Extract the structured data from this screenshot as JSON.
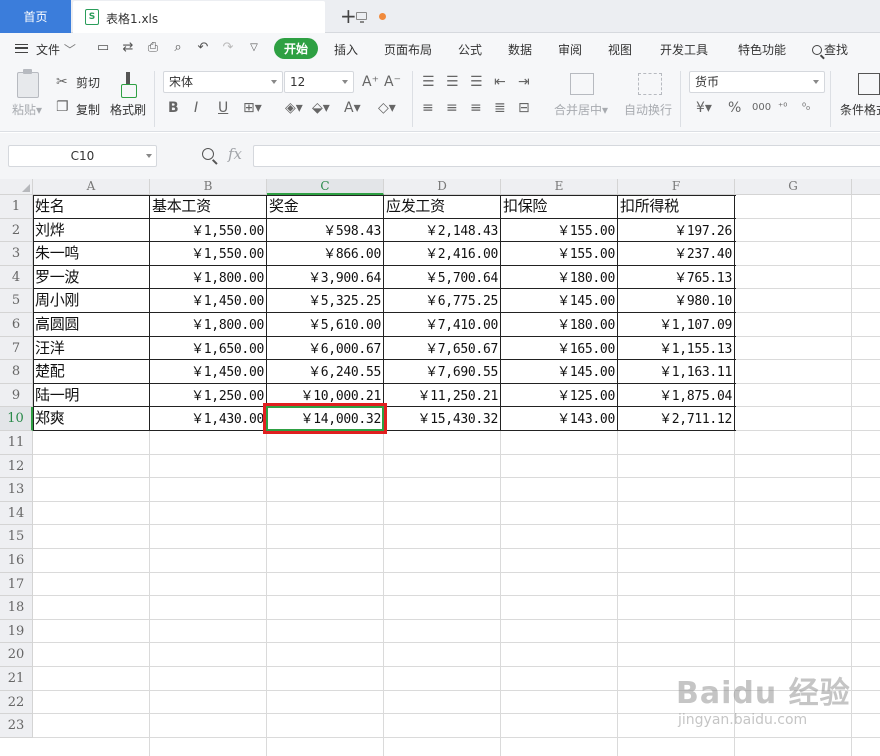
{
  "tabs": {
    "home": "首页",
    "document": "表格1.xls",
    "doc_icon": "S"
  },
  "menu": {
    "file": "文件",
    "start": "开始",
    "items": [
      "插入",
      "页面布局",
      "公式",
      "数据",
      "审阅",
      "视图",
      "开发工具",
      "特色功能"
    ],
    "search": "查找"
  },
  "ribbon": {
    "paste": "粘贴",
    "cut": "剪切",
    "copy": "复制",
    "format_painter": "格式刷",
    "font_name": "宋体",
    "font_size": "12",
    "merge_center": "合并居中",
    "auto_wrap": "自动换行",
    "number_format": "货币",
    "conditional_format": "条件格式"
  },
  "formula_bar": {
    "name_box": "C10",
    "fx": "fx",
    "formula": ""
  },
  "sheet": {
    "selected_cell": "C10",
    "columns": [
      "A",
      "B",
      "C",
      "D",
      "E",
      "F",
      "G"
    ],
    "rows": [
      "1",
      "2",
      "3",
      "4",
      "5",
      "6",
      "7",
      "8",
      "9",
      "10",
      "11",
      "12",
      "13",
      "14",
      "15",
      "16",
      "17",
      "18",
      "19",
      "20",
      "21",
      "22",
      "23"
    ],
    "headers": [
      "姓名",
      "基本工资",
      "奖金",
      "应发工资",
      "扣保险",
      "扣所得税"
    ],
    "data": [
      [
        "刘烨",
        "￥1,550.00",
        "￥598.43",
        "￥2,148.43",
        "￥155.00",
        "￥197.26"
      ],
      [
        "朱一鸣",
        "￥1,550.00",
        "￥866.00",
        "￥2,416.00",
        "￥155.00",
        "￥237.40"
      ],
      [
        "罗一波",
        "￥1,800.00",
        "￥3,900.64",
        "￥5,700.64",
        "￥180.00",
        "￥765.13"
      ],
      [
        "周小刚",
        "￥1,450.00",
        "￥5,325.25",
        "￥6,775.25",
        "￥145.00",
        "￥980.10"
      ],
      [
        "高圆圆",
        "￥1,800.00",
        "￥5,610.00",
        "￥7,410.00",
        "￥180.00",
        "￥1,107.09"
      ],
      [
        "汪洋",
        "￥1,650.00",
        "￥6,000.67",
        "￥7,650.67",
        "￥165.00",
        "￥1,155.13"
      ],
      [
        "楚配",
        "￥1,450.00",
        "￥6,240.55",
        "￥7,690.55",
        "￥145.00",
        "￥1,163.11"
      ],
      [
        "陆一明",
        "￥1,250.00",
        "￥10,000.21",
        "￥11,250.21",
        "￥125.00",
        "￥1,875.04"
      ],
      [
        "郑爽",
        "￥1,430.00",
        "￥14,000.32",
        "￥15,430.32",
        "￥143.00",
        "￥2,711.12"
      ]
    ]
  },
  "watermark": {
    "brand": "Baidu 经验",
    "url": "jingyan.baidu.com"
  },
  "colors": {
    "accent_green": "#2ea043",
    "home_tab_blue": "#3b7ddb",
    "highlight_red": "#e02020"
  }
}
